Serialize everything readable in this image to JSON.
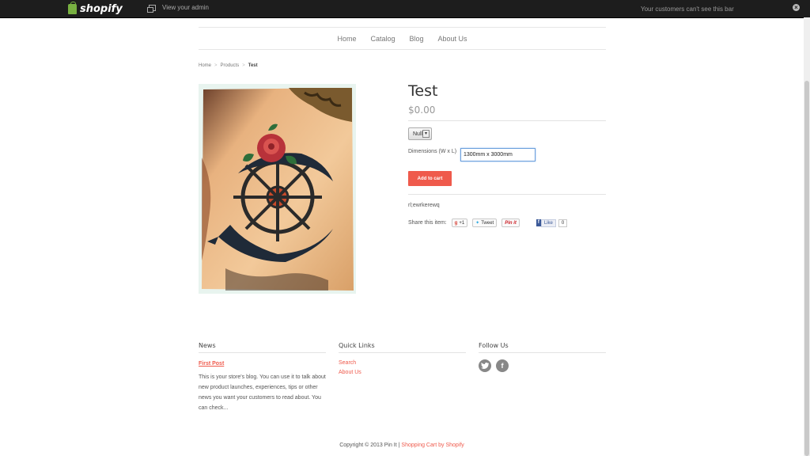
{
  "adminbar": {
    "logo": "shopify",
    "view_admin": "View your admin",
    "note": "Your customers can't see this bar",
    "close": "×"
  },
  "nav": [
    "Home",
    "Catalog",
    "Blog",
    "About Us"
  ],
  "breadcrumb": {
    "home": "Home",
    "products": "Products",
    "current": "Test"
  },
  "product": {
    "title": "Test",
    "price": "$0.00",
    "variant_selected": "Null",
    "dimensions_label": "Dimensions (W x L)",
    "dimensions_value": "1300mm x 3000mm",
    "add_to_cart": "Add to cart",
    "description": "rl;ewrkerewq",
    "share_label": "Share this item:",
    "share": {
      "gplus": "+1",
      "tweet": "Tweet",
      "pinit": "Pin it",
      "fb_like": "Like",
      "fb_count": "0"
    }
  },
  "footer": {
    "news": {
      "heading": "News",
      "post_title": "First Post",
      "post_excerpt": "This is your store's blog. You can use it to talk about new product launches, experiences, tips or other news you want your customers to read about. You can check..."
    },
    "quick_links": {
      "heading": "Quick Links",
      "links": [
        "Search",
        "About Us"
      ]
    },
    "follow": {
      "heading": "Follow Us",
      "icons": [
        "twitter-icon",
        "facebook-icon"
      ]
    },
    "copyright": "Copyright © 2013 Pin It |",
    "powered": "Shopping Cart by Shopify"
  },
  "colors": {
    "accent": "#ef5a4c",
    "adminbar": "#1d1d1d"
  }
}
